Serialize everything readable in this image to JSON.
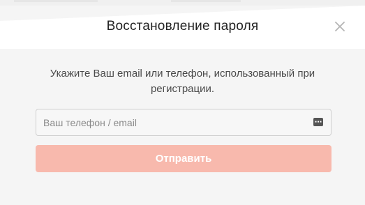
{
  "dialog": {
    "title": "Восстановление пароля",
    "instruction": "Укажите Ваш email или телефон, использованный при регистрации.",
    "contact_field": {
      "placeholder": "Ваш телефон / email",
      "value": ""
    },
    "submit_label": "Отправить",
    "close_icon": "close-icon",
    "field_icon": "keyboard-icon"
  },
  "colors": {
    "accent": "#f8b9ad",
    "background": "#f5f5f5",
    "header": "#ffffff",
    "title_text": "#222222",
    "body_text": "#4a4a4a"
  }
}
